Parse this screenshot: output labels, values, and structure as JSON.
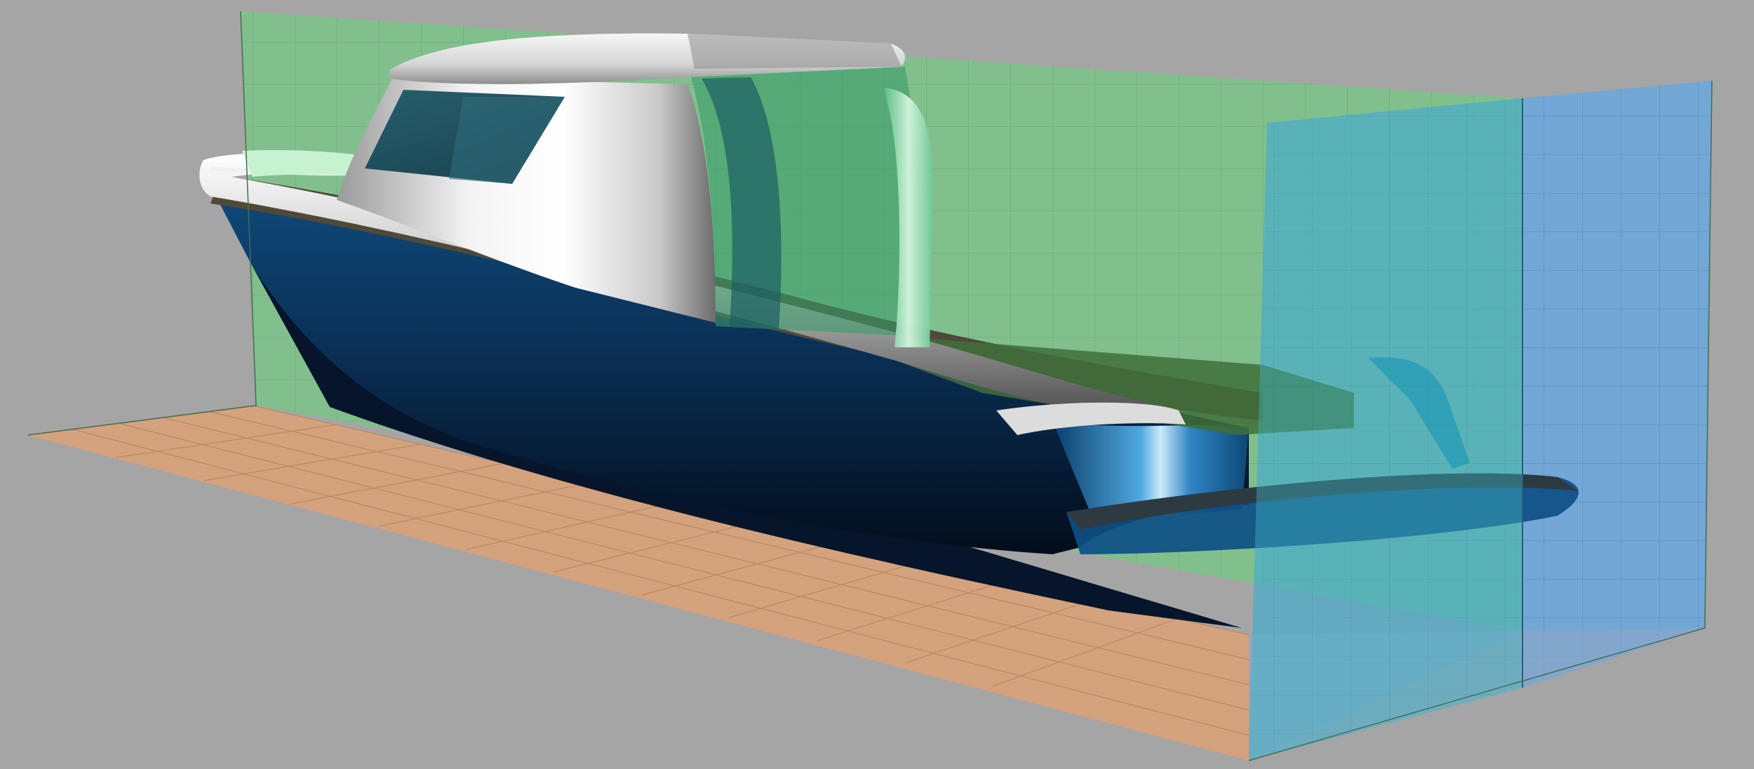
{
  "viewport": {
    "view": "perspective",
    "background_color": "#a6a6a6",
    "display_mode": "shaded"
  },
  "model": {
    "subject": "boat-hull-with-cabin",
    "hull_color": "#0b3a63",
    "cabin_color": "#e8e8e8",
    "deck_color": "#4a4638"
  },
  "construction_planes": [
    {
      "name": "side-plane",
      "color": "#7cc48a"
    },
    {
      "name": "ground-plane",
      "color": "#d9a47a"
    },
    {
      "name": "transom-plane",
      "color": "#6fa7d6"
    },
    {
      "name": "section-plane",
      "color": "#3fb8c4"
    }
  ]
}
